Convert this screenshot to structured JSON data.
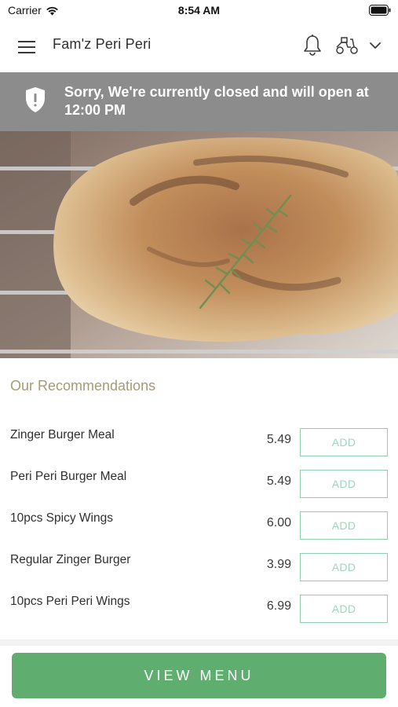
{
  "status_bar": {
    "carrier": "Carrier",
    "time": "8:54 AM",
    "icons": [
      "wifi-icon",
      "battery-icon"
    ]
  },
  "header": {
    "title": "Fam'z Peri Peri",
    "icons": [
      "menu-icon",
      "bell-icon",
      "scooter-icon",
      "chevron-down-icon"
    ]
  },
  "closed_banner": {
    "message": "Sorry, We're currently closed and will open at 12:00 PM",
    "icon": "shield-alert-icon",
    "background_color": "#8c8c8c"
  },
  "hero": {
    "image": "grilled-chicken-photo"
  },
  "recommendations": {
    "title": "Our Recommendations",
    "add_label": "ADD",
    "items": [
      {
        "name": "Zinger Burger Meal",
        "price": "5.49"
      },
      {
        "name": "Peri Peri Burger Meal",
        "price": "5.49"
      },
      {
        "name": "10pcs Spicy Wings",
        "price": "6.00"
      },
      {
        "name": "Regular Zinger Burger",
        "price": "3.99"
      },
      {
        "name": "10pcs Peri Peri Wings",
        "price": "6.99"
      }
    ]
  },
  "footer": {
    "view_menu_label": "VIEW MENU",
    "accent_color": "#5fae70"
  }
}
